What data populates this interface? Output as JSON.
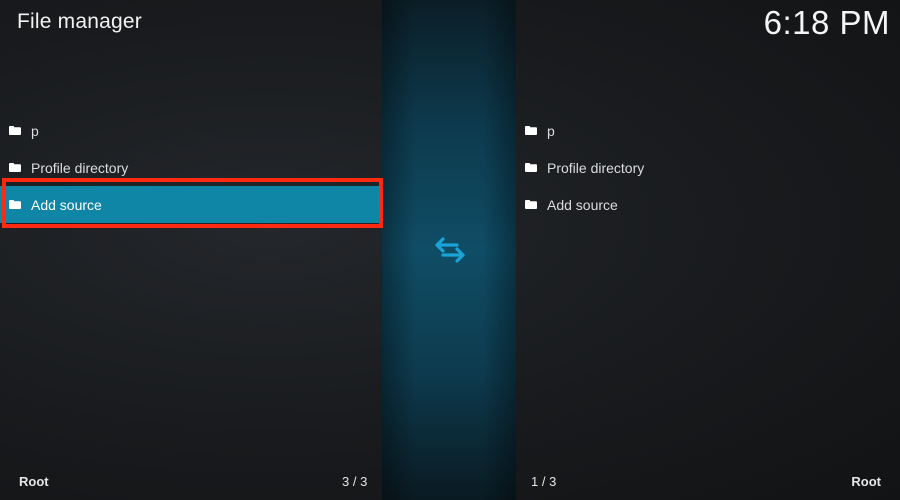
{
  "header": {
    "title": "File manager",
    "clock": "6:18 PM"
  },
  "left_pane": {
    "items": [
      {
        "label": "p",
        "icon": "folder-icon"
      },
      {
        "label": "Profile directory",
        "icon": "folder-icon"
      },
      {
        "label": "Add source",
        "icon": "folder-icon",
        "selected": true
      }
    ],
    "footer_label": "Root",
    "footer_count": "3 / 3"
  },
  "right_pane": {
    "items": [
      {
        "label": "p",
        "icon": "folder-icon"
      },
      {
        "label": "Profile directory",
        "icon": "folder-icon"
      },
      {
        "label": "Add source",
        "icon": "folder-icon"
      }
    ],
    "footer_label": "Root",
    "footer_count": "1 / 3"
  },
  "center": {
    "icon": "swap-arrows-icon"
  },
  "colors": {
    "selection": "#0f86a6",
    "highlight_outline": "#ff2a10",
    "accent_icon": "#1aa3d6"
  }
}
